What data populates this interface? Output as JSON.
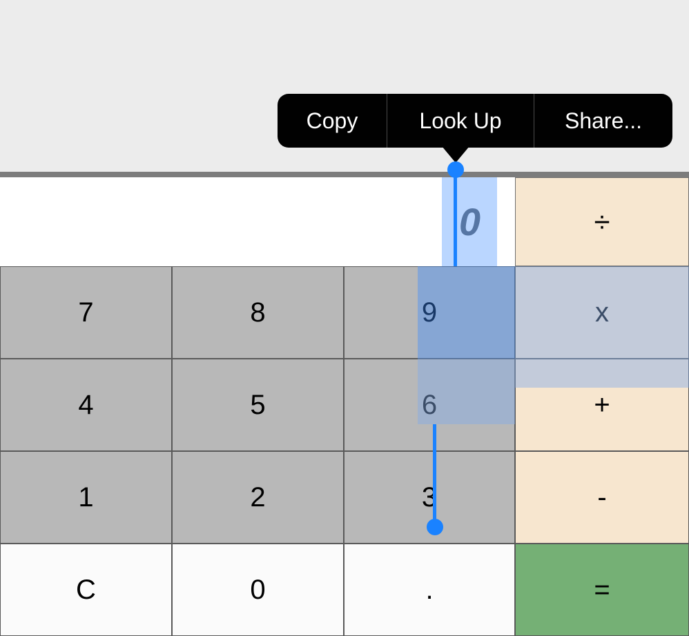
{
  "context_menu": {
    "copy": "Copy",
    "lookup": "Look Up",
    "share": "Share..."
  },
  "display": {
    "value": "0"
  },
  "operators": {
    "divide": "÷",
    "multiply": "x",
    "plus": "+",
    "minus": "-",
    "equals": "="
  },
  "keys": {
    "k7": "7",
    "k8": "8",
    "k9": "9",
    "k4": "4",
    "k5": "5",
    "k6": "6",
    "k1": "1",
    "k2": "2",
    "k3": "3",
    "clear": "C",
    "k0": "0",
    "dot": "."
  }
}
